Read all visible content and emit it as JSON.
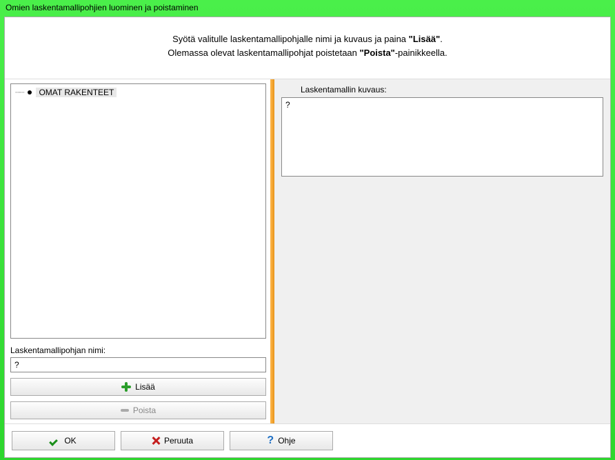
{
  "window": {
    "title": "Omien laskentamallipohjien luominen ja poistaminen"
  },
  "instructions": {
    "line1_pre": "Syötä valitulle laskentamallipohjalle nimi ja kuvaus ja paina ",
    "line1_bold": "\"Lisää\"",
    "line1_post": ".",
    "line2_pre": "Olemassa olevat laskentamallipohjat poistetaan ",
    "line2_bold": "\"Poista\"",
    "line2_post": "-painikkeella."
  },
  "tree": {
    "root_label": "OMAT RAKENTEET"
  },
  "left": {
    "name_label": "Laskentamallipohjan nimi:",
    "name_value": "?",
    "add_label": "Lisää",
    "remove_label": "Poista"
  },
  "right": {
    "desc_label": "Laskentamallin kuvaus:",
    "desc_value": "?"
  },
  "footer": {
    "ok": "OK",
    "cancel": "Peruuta",
    "help": "Ohje"
  }
}
